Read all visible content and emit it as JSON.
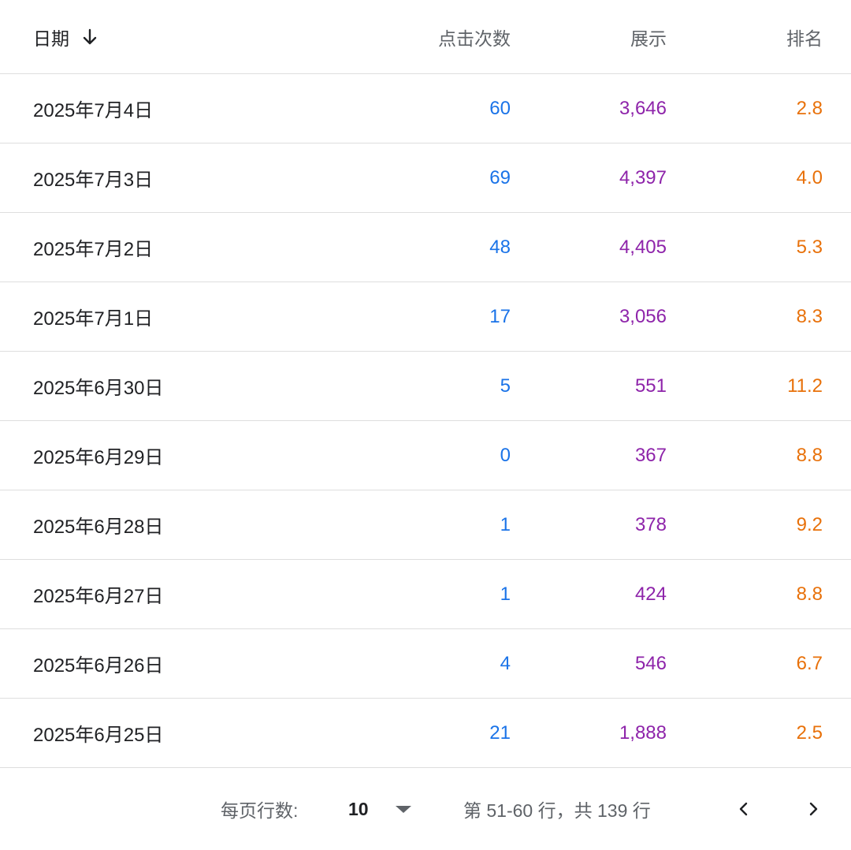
{
  "header": {
    "date": "日期",
    "clicks": "点击次数",
    "impressions": "展示",
    "position": "排名"
  },
  "rows": [
    {
      "date": "2025年7月4日",
      "clicks": "60",
      "impressions": "3,646",
      "position": "2.8"
    },
    {
      "date": "2025年7月3日",
      "clicks": "69",
      "impressions": "4,397",
      "position": "4.0"
    },
    {
      "date": "2025年7月2日",
      "clicks": "48",
      "impressions": "4,405",
      "position": "5.3"
    },
    {
      "date": "2025年7月1日",
      "clicks": "17",
      "impressions": "3,056",
      "position": "8.3"
    },
    {
      "date": "2025年6月30日",
      "clicks": "5",
      "impressions": "551",
      "position": "11.2"
    },
    {
      "date": "2025年6月29日",
      "clicks": "0",
      "impressions": "367",
      "position": "8.8"
    },
    {
      "date": "2025年6月28日",
      "clicks": "1",
      "impressions": "378",
      "position": "9.2"
    },
    {
      "date": "2025年6月27日",
      "clicks": "1",
      "impressions": "424",
      "position": "8.8"
    },
    {
      "date": "2025年6月26日",
      "clicks": "4",
      "impressions": "546",
      "position": "6.7"
    },
    {
      "date": "2025年6月25日",
      "clicks": "21",
      "impressions": "1,888",
      "position": "2.5"
    }
  ],
  "pagination": {
    "rows_per_page_label": "每页行数:",
    "rows_per_page_value": "10",
    "range_text": "第 51-60 行，共 139 行"
  },
  "icons": {
    "sort": "arrow-down-icon",
    "dropdown": "dropdown-triangle-icon",
    "prev": "chevron-left-icon",
    "next": "chevron-right-icon"
  },
  "colors": {
    "clicks": "#1a73e8",
    "impressions": "#8e24aa",
    "position": "#e8710a"
  }
}
